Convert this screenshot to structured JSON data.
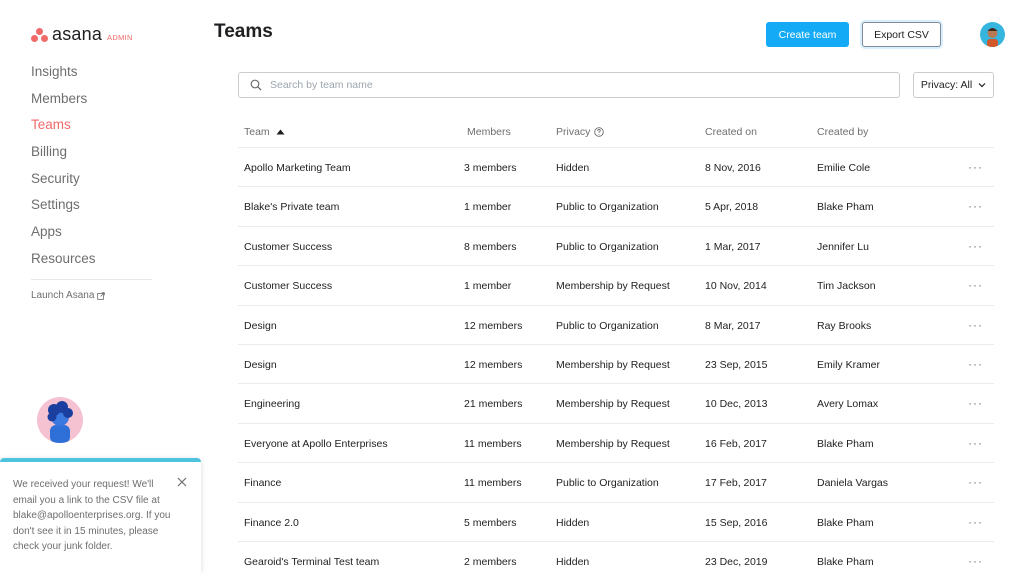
{
  "logo": {
    "word": "asana",
    "badge": "ADMIN"
  },
  "sidebar": {
    "items": [
      {
        "label": "Insights",
        "active": false
      },
      {
        "label": "Members",
        "active": false
      },
      {
        "label": "Teams",
        "active": true
      },
      {
        "label": "Billing",
        "active": false
      },
      {
        "label": "Security",
        "active": false
      },
      {
        "label": "Settings",
        "active": false
      },
      {
        "label": "Apps",
        "active": false
      },
      {
        "label": "Resources",
        "active": false
      }
    ],
    "launch_label": "Launch Asana"
  },
  "toast": {
    "message": "We received your request! We'll email you a link to the CSV file at blake@apolloenterprises.org. If you don't see it in 15 minutes, please check your junk folder."
  },
  "header": {
    "title": "Teams",
    "create_label": "Create team",
    "export_label": "Export CSV"
  },
  "search": {
    "placeholder": "Search by team name",
    "value": ""
  },
  "filter": {
    "label": "Privacy: All"
  },
  "table": {
    "columns": {
      "team": "Team",
      "members": "Members",
      "privacy": "Privacy",
      "created_on": "Created on",
      "created_by": "Created by"
    },
    "rows": [
      {
        "team": "Apollo Marketing Team",
        "members": "3 members",
        "privacy": "Hidden",
        "created_on": "8 Nov, 2016",
        "created_by": "Emilie Cole"
      },
      {
        "team": "Blake's Private team",
        "members": "1 member",
        "privacy": "Public to Organization",
        "created_on": "5 Apr, 2018",
        "created_by": "Blake Pham"
      },
      {
        "team": "Customer Success",
        "members": "8 members",
        "privacy": "Public to Organization",
        "created_on": "1 Mar, 2017",
        "created_by": "Jennifer Lu"
      },
      {
        "team": "Customer Success",
        "members": "1 member",
        "privacy": "Membership by Request",
        "created_on": "10 Nov, 2014",
        "created_by": "Tim Jackson"
      },
      {
        "team": "Design",
        "members": "12 members",
        "privacy": "Public to Organization",
        "created_on": "8 Mar, 2017",
        "created_by": "Ray Brooks"
      },
      {
        "team": "Design",
        "members": "12 members",
        "privacy": "Membership by Request",
        "created_on": "23 Sep, 2015",
        "created_by": "Emily Kramer"
      },
      {
        "team": "Engineering",
        "members": "21 members",
        "privacy": "Membership by Request",
        "created_on": "10 Dec, 2013",
        "created_by": "Avery Lomax"
      },
      {
        "team": "Everyone at Apollo Enterprises",
        "members": "11 members",
        "privacy": "Membership by Request",
        "created_on": "16 Feb, 2017",
        "created_by": "Blake Pham"
      },
      {
        "team": "Finance",
        "members": "11 members",
        "privacy": "Public to Organization",
        "created_on": "17 Feb, 2017",
        "created_by": "Daniela Vargas"
      },
      {
        "team": "Finance 2.0",
        "members": "5 members",
        "privacy": "Hidden",
        "created_on": "15 Sep, 2016",
        "created_by": "Blake Pham"
      },
      {
        "team": "Gearoid's Terminal Test team",
        "members": "2 members",
        "privacy": "Hidden",
        "created_on": "23 Dec, 2019",
        "created_by": "Blake Pham"
      }
    ],
    "more_label": "···"
  },
  "colors": {
    "accent": "#f06a6a",
    "primary_button": "#14aaf5",
    "toast_bar": "#4ec3dd"
  },
  "icons": {
    "search": "search-icon",
    "info": "info-icon",
    "sort": "sort-up-icon",
    "external": "external-link-icon",
    "close": "close-icon",
    "chevron": "chevron-down-icon"
  }
}
